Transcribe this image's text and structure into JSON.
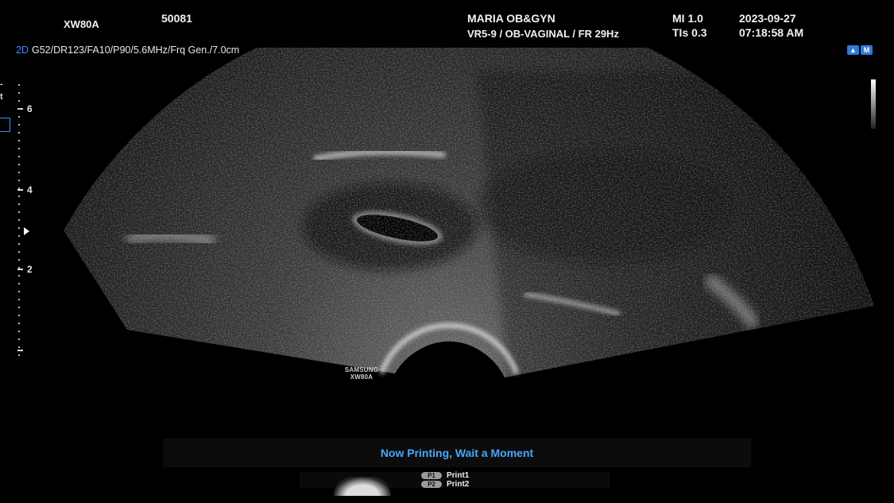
{
  "header": {
    "model": "XW80A",
    "patient_id": "50081",
    "institution": "MARIA OB&GYN",
    "probe_preset": "VR5-9 / OB-VAGINAL / FR 29Hz",
    "mi": "MI  1.0",
    "tis": "TIs 0.3",
    "date": "2023-09-27",
    "time": "07:18:58 AM"
  },
  "imaging_params": {
    "mode": "2D",
    "settings": "G52/DR123/FA10/P90/5.6MHz/Frq Gen./7.0cm"
  },
  "depth_scale": {
    "labels": [
      "6",
      "4",
      "2"
    ]
  },
  "left_glyphs": [
    "-",
    "t"
  ],
  "orientation_icons": [
    "▲",
    "M"
  ],
  "watermark": {
    "line1": "SAMSUNG",
    "line2": "XW80A"
  },
  "status": {
    "message": "Now Printing, Wait a Moment"
  },
  "print_keys": [
    {
      "badge": "P1",
      "label": "Print1"
    },
    {
      "badge": "P2",
      "label": "Print2"
    }
  ],
  "colors": {
    "accent_blue": "#3a8dff",
    "status_text": "#49a6ff",
    "background": "#000000"
  }
}
